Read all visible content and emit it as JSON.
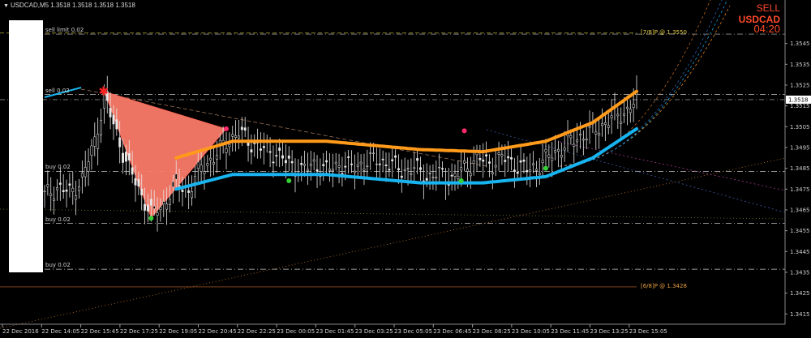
{
  "header": {
    "symbol_line": "USDCAD,M5  1.3518 1.3518 1.3518 1.3518"
  },
  "signal_panel": {
    "direction": "SELL",
    "symbol": "USDCAD",
    "time": "04:20"
  },
  "order_labels": [
    {
      "text": "sell limit 0.02",
      "price": 1.35495
    },
    {
      "text": "sell 0.02",
      "price": 1.35205
    },
    {
      "text": "buy 0.02",
      "price": 1.34835
    },
    {
      "text": "buy 0.02",
      "price": 1.34585
    },
    {
      "text": "buy 0.02",
      "price": 1.34365
    }
  ],
  "fib_labels": [
    {
      "text": "[7/8]P @ 1.3550",
      "price": 1.355,
      "color": "#e8d04a"
    },
    {
      "text": "[6/8]P @ 1.3428",
      "price": 1.3428,
      "color": "#e8a040"
    }
  ],
  "colors": {
    "background": "#000000",
    "upper_channel": "#ff9a1a",
    "lower_channel": "#18b4f0",
    "triangle": "#fa7a68",
    "current_price_label_bg": "#ffffff",
    "candles": "#e8e8e8",
    "grid": "#ffffff"
  },
  "chart_data": {
    "type": "candlestick",
    "symbol": "USDCAD",
    "timeframe": "M5",
    "ylim": [
      1.3412,
      1.3562
    ],
    "price_axis_ticks": [
      "1.3545",
      "1.3535",
      "1.3525",
      "1.3515",
      "1.3505",
      "1.3495",
      "1.3485",
      "1.3475",
      "1.3465",
      "1.3455",
      "1.3445",
      "1.3435",
      "1.3425",
      "1.3415"
    ],
    "current_price": "1.3518",
    "time_axis_ticks": [
      "22 Dec 2016",
      "22 Dec 14:05",
      "22 Dec 15:45",
      "22 Dec 17:25",
      "22 Dec 19:05",
      "22 Dec 20:45",
      "22 Dec 22:25",
      "23 Dec 00:05",
      "23 Dec 01:45",
      "23 Dec 03:25",
      "23 Dec 05:05",
      "23 Dec 06:45",
      "23 Dec 08:25",
      "23 Dec 10:05",
      "23 Dec 11:45",
      "23 Dec 13:25",
      "23 Dec 15:05"
    ],
    "bar_count": 190,
    "close_profile": [
      [
        0,
        1.3472
      ],
      [
        4,
        1.3476
      ],
      [
        8,
        1.3473
      ],
      [
        12,
        1.348
      ],
      [
        16,
        1.3498
      ],
      [
        19,
        1.3519
      ],
      [
        22,
        1.3506
      ],
      [
        26,
        1.3488
      ],
      [
        30,
        1.3475
      ],
      [
        34,
        1.3463
      ],
      [
        38,
        1.3468
      ],
      [
        42,
        1.3478
      ],
      [
        46,
        1.3474
      ],
      [
        50,
        1.3486
      ],
      [
        54,
        1.349
      ],
      [
        58,
        1.3498
      ],
      [
        62,
        1.3502
      ],
      [
        66,
        1.3497
      ],
      [
        70,
        1.3494
      ],
      [
        74,
        1.3492
      ],
      [
        78,
        1.3487
      ],
      [
        82,
        1.3484
      ],
      [
        86,
        1.3487
      ],
      [
        90,
        1.3484
      ],
      [
        94,
        1.3487
      ],
      [
        98,
        1.3485
      ],
      [
        102,
        1.3488
      ],
      [
        106,
        1.3489
      ],
      [
        110,
        1.3487
      ],
      [
        114,
        1.3484
      ],
      [
        118,
        1.3485
      ],
      [
        122,
        1.3481
      ],
      [
        126,
        1.3482
      ],
      [
        130,
        1.348
      ],
      [
        134,
        1.3485
      ],
      [
        138,
        1.349
      ],
      [
        142,
        1.3487
      ],
      [
        146,
        1.349
      ],
      [
        150,
        1.3487
      ],
      [
        154,
        1.3484
      ],
      [
        158,
        1.3487
      ],
      [
        162,
        1.3492
      ],
      [
        166,
        1.3496
      ],
      [
        170,
        1.35
      ],
      [
        174,
        1.3502
      ],
      [
        178,
        1.3506
      ],
      [
        182,
        1.351
      ],
      [
        186,
        1.3513
      ],
      [
        189,
        1.3518
      ]
    ],
    "channel_upper": [
      [
        42,
        1.349
      ],
      [
        60,
        1.3498
      ],
      [
        90,
        1.3498
      ],
      [
        120,
        1.3494
      ],
      [
        140,
        1.3493
      ],
      [
        160,
        1.3498
      ],
      [
        175,
        1.3507
      ],
      [
        189,
        1.3522
      ]
    ],
    "channel_lower": [
      [
        42,
        1.3475
      ],
      [
        60,
        1.3482
      ],
      [
        90,
        1.3482
      ],
      [
        120,
        1.3478
      ],
      [
        140,
        1.3478
      ],
      [
        160,
        1.3481
      ],
      [
        175,
        1.349
      ],
      [
        189,
        1.3504
      ]
    ],
    "triangle_points": [
      [
        19,
        1.3522
      ],
      [
        34,
        1.3461
      ],
      [
        58,
        1.3504
      ]
    ],
    "swing_markers": [
      {
        "bar": 19,
        "price": 1.3522,
        "color": "#ff2a2a"
      },
      {
        "bar": 34,
        "price": 1.3461,
        "color": "#35d035"
      },
      {
        "bar": 58,
        "price": 1.3504,
        "color": "#ff2a6a"
      },
      {
        "bar": 78,
        "price": 1.3479,
        "color": "#35d035"
      },
      {
        "bar": 134,
        "price": 1.3503,
        "color": "#ff2a6a"
      },
      {
        "bar": 133,
        "price": 1.3479,
        "color": "#35d035"
      },
      {
        "bar": 160,
        "price": 1.3485,
        "color": "#35d035"
      }
    ]
  }
}
